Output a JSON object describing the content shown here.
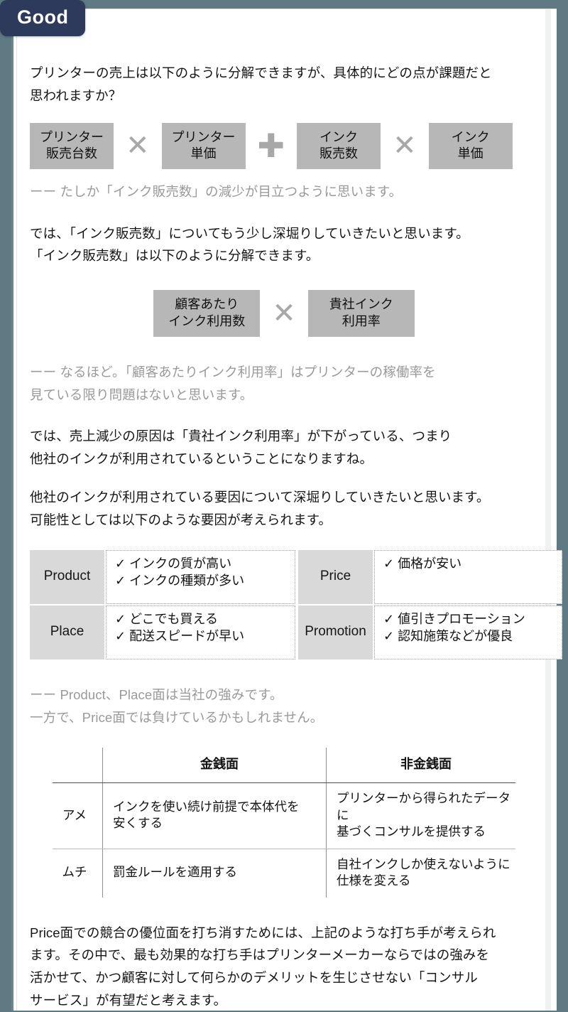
{
  "badge": {
    "label": "Good"
  },
  "intro": {
    "paragraph": "プリンターの売上は以下のように分解できますが、具体的にどの点が課題だと\n思われますか？"
  },
  "formula1": {
    "boxes": [
      {
        "text": "プリンター\n販売台数"
      },
      {
        "text": "プリンター\n単価"
      },
      {
        "text": "インク\n販売数"
      },
      {
        "text": "インク\n単価"
      }
    ],
    "operators": {
      "multiply": "✕",
      "plus": "✚"
    }
  },
  "reply1": {
    "text": "ーー たしか「インク販売数」の減少が目立つように思います。"
  },
  "para2": {
    "text": "では、「インク販売数」についてもう少し深堀りしていきたいと思います。\n「インク販売数」は以下のように分解できます。"
  },
  "formula2": {
    "boxes": [
      {
        "text": "顧客あたり\nインク利用数"
      },
      {
        "text": "貴社インク\n利用率"
      }
    ],
    "operator": "✕"
  },
  "reply2": {
    "text": "ーー なるほど。「顧客あたりインク利用率」はプリンターの稼働率を\n        見ている限り問題はないと思います。"
  },
  "para3": {
    "text": "では、売上減少の原因は「貴社インク利用率」が下がっている、つまり\n他社のインクが利用されているということになりますね。"
  },
  "para4": {
    "text": "他社のインクが利用されている要因について深堀りしていきたいと思います。\n可能性としては以下のような要因が考えられます。"
  },
  "fourp": {
    "cells": [
      {
        "label": "Product",
        "items": "✓ インクの質が高い\n✓ インクの種類が多い"
      },
      {
        "label": "Price",
        "items": "✓ 価格が安い"
      },
      {
        "label": "Place",
        "items": "✓ どこでも買える\n✓ 配送スピードが早い"
      },
      {
        "label": "Promotion",
        "items": "✓ 値引きプロモーション\n✓ 認知施策などが優良"
      }
    ]
  },
  "reply3": {
    "text": "ーー Product、Place面は当社の強みです。\n         一方で、Price面では負けているかもしれません。"
  },
  "table": {
    "corner": "",
    "headers": [
      "金銭面",
      "非金銭面"
    ],
    "rows": [
      {
        "head": "アメ",
        "monetary": "インクを使い続け前提で本体代を\n安くする",
        "nonmonetary": "プリンターから得られたデータに\n基づくコンサルを提供する"
      },
      {
        "head": "ムチ",
        "monetary": "罰金ルールを適用する",
        "nonmonetary": "自社インクしか使えないように\n仕様を変える"
      }
    ]
  },
  "conclusion": {
    "text": "Price面での競合の優位面を打ち消すためには、上記のような打ち手が考えられ\nます。その中で、最も効果的な打ち手はプリンターメーカーならではの強みを\n活かせて、かつ顧客に対して何らかのデメリットを生じさせない「コンサル\nサービス」が有望だと考えます。"
  },
  "colors": {
    "badge_bg": "#2e3a5c",
    "page_bg": "#5f7a82",
    "formula_box_bg": "#b7b7b7",
    "label_box_bg": "#d9d9d9",
    "reply_text": "#9a9a9a",
    "body_text": "#141414"
  }
}
